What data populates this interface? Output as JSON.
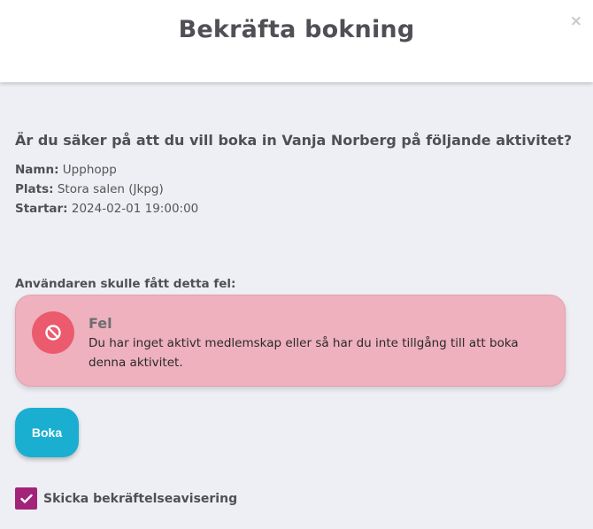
{
  "modal": {
    "title": "Bekräfta bokning",
    "close": "×"
  },
  "question": "Är du säker på att du vill boka in Vanja Norberg på följande aktivitet?",
  "details": [
    {
      "label": "Namn:",
      "value": "Upphopp"
    },
    {
      "label": "Plats:",
      "value": "Stora salen (Jkpg)"
    },
    {
      "label": "Startar:",
      "value": "2024-02-01 19:00:00"
    }
  ],
  "error_caption": "Användaren skulle fått detta fel:",
  "alert": {
    "icon": "no-entry-icon",
    "title": "Fel",
    "message": "Du har inget aktivt medlemskap eller så har du inte tillgång till att boka denna aktivitet."
  },
  "book_button": "Boka",
  "notification": {
    "checked": true,
    "label": "Skicka bekräftelseavisering"
  },
  "colors": {
    "primary": "#1aafd0",
    "error_bg": "#eeb1bd",
    "error_icon": "#ec5a6d",
    "checkbox": "#a3237b"
  }
}
